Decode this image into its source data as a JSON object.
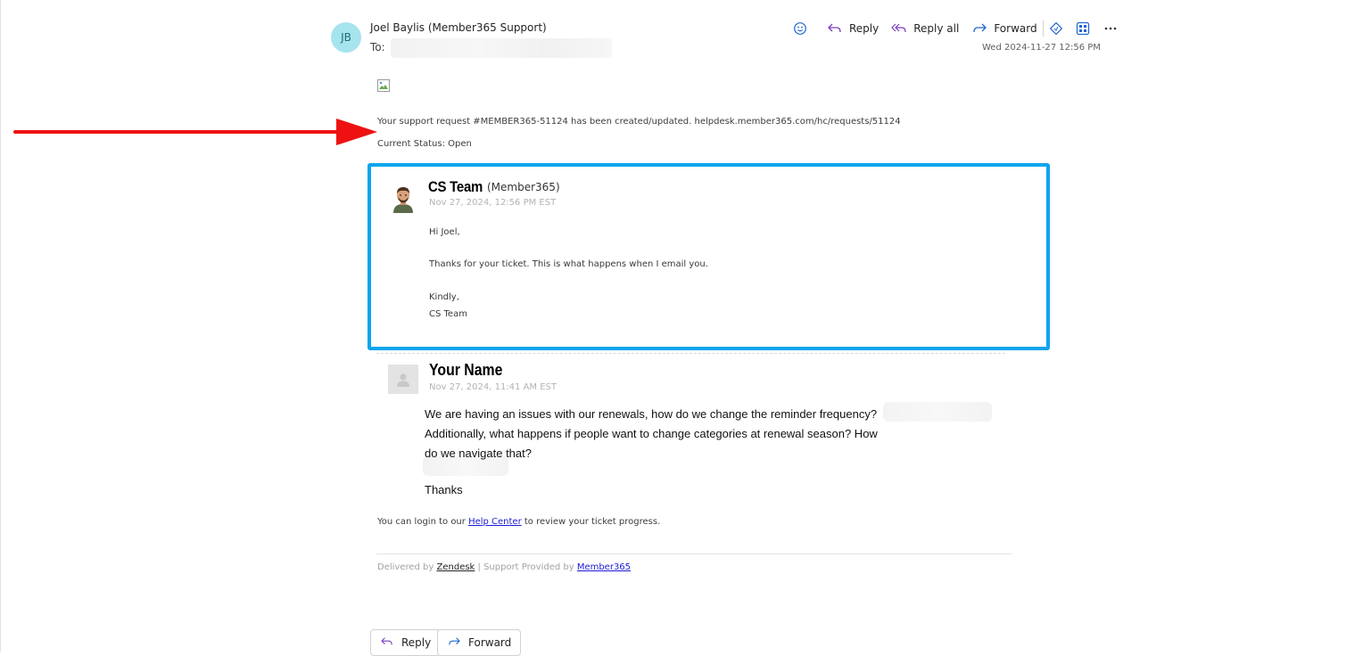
{
  "header": {
    "avatar_initials": "JB",
    "sender": "Joel Baylis (Member365 Support)",
    "to_label": "To:",
    "datetime": "Wed 2024-11-27 12:56 PM"
  },
  "toolbar": {
    "emoji_icon": "smiley-icon",
    "reply_label": "Reply",
    "reply_all_label": "Reply all",
    "forward_label": "Forward",
    "more_icon": "ellipsis-icon"
  },
  "body": {
    "support_line": "Your support request #MEMBER365-51124 has been created/updated. helpdesk.member365.com/hc/requests/51124",
    "status_line": "Current Status: Open"
  },
  "cs_message": {
    "author": "CS Team",
    "org": "(Member365)",
    "date": "Nov 27, 2024, 12:56 PM EST",
    "greeting": "Hi Joel,",
    "text": "Thanks for your ticket. This is what happens when I email you.",
    "signoff": "Kindly,",
    "signature": "CS Team"
  },
  "user_message": {
    "author": "Your Name",
    "date": "Nov 27, 2024, 11:41 AM EST",
    "text": "We are having an issues with our renewals, how do we change the reminder frequency? Additionally, what happens if people want to change categories at renewal season? How do we navigate that?",
    "thanks": "Thanks"
  },
  "footer": {
    "login_prefix": "You can login to our ",
    "help_center_link": "Help Center",
    "login_suffix": " to review your ticket progress.",
    "delivered_by": "Delivered by ",
    "zendesk_link": "Zendesk",
    "support_provided": " | Support Provided by ",
    "member365_link": "Member365"
  },
  "bottom_buttons": {
    "reply_label": "Reply",
    "forward_label": "Forward"
  },
  "colors": {
    "highlight_border": "#0ba5ec",
    "arrow": "#ee1111",
    "action_icon": "#7a3fbf",
    "forward_icon": "#2266cc"
  }
}
